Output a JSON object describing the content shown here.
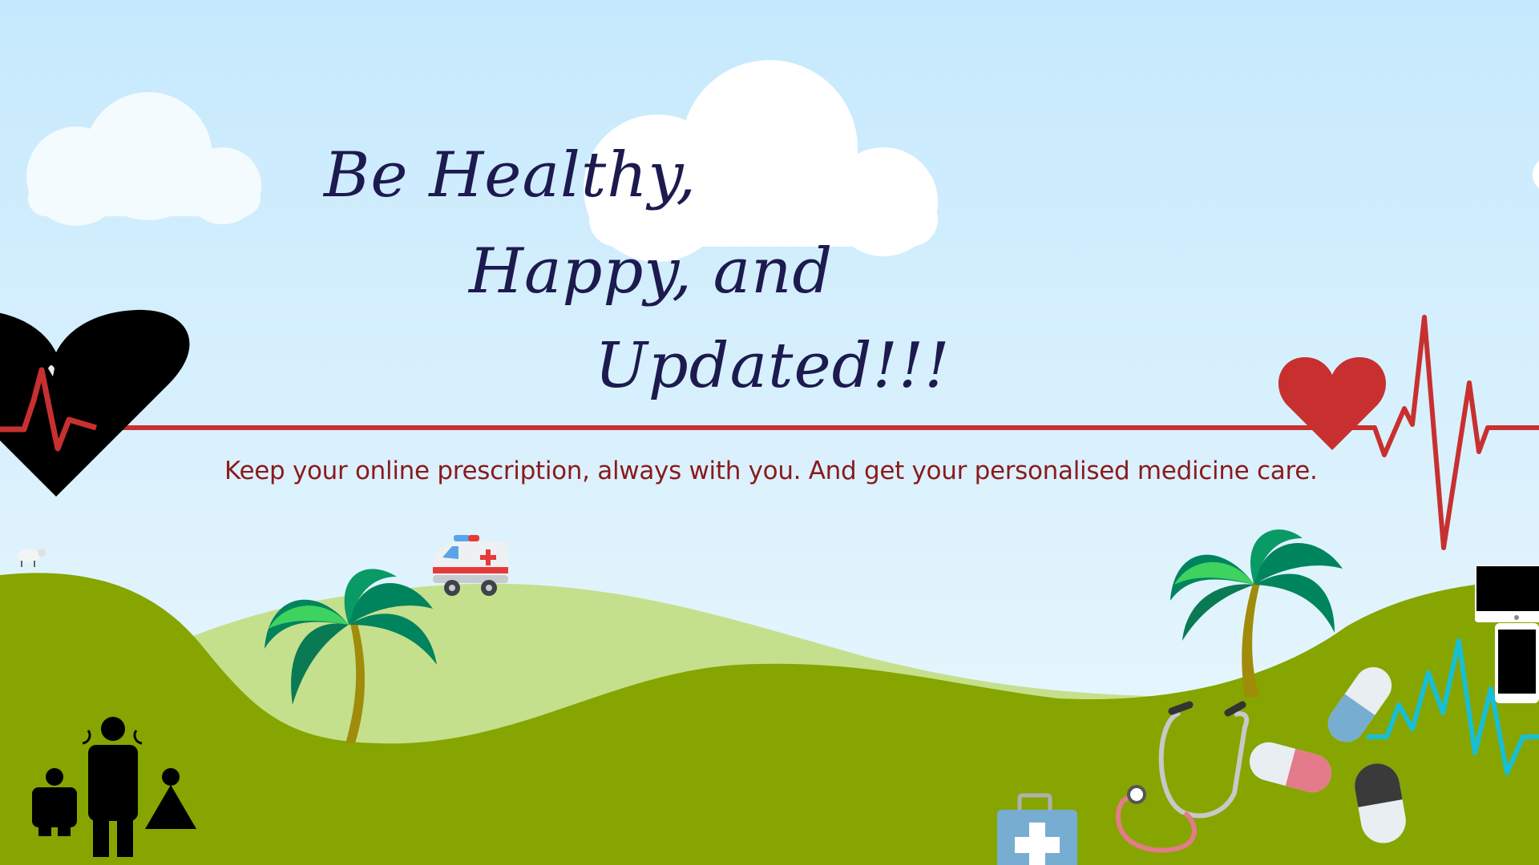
{
  "headline": {
    "line1": "Be Healthy,",
    "line2": "Happy, and",
    "line3": "Updated!!!"
  },
  "tagline": "Keep your online prescription, always with you. And get your personalised medicine care.",
  "colors": {
    "sky_top": "#c6e9fd",
    "sky_bottom": "#ecf8fd",
    "hill_back": "#c5e08c",
    "hill_front": "#86a500",
    "heartbeat_red": "#c83030",
    "heartbeat_cyan": "#17bfd6",
    "headline": "#1c1a4f",
    "tagline": "#8a1a1c"
  },
  "icons": [
    "black-heart-icon",
    "red-heart-icon",
    "heartbeat-line-icon",
    "ambulance-icon",
    "palm-tree-icon",
    "sheep-icon",
    "family-icon",
    "stethoscope-icon",
    "first-aid-kit-icon",
    "pill-capsule-icon",
    "monitor-icon",
    "smartphone-icon"
  ]
}
